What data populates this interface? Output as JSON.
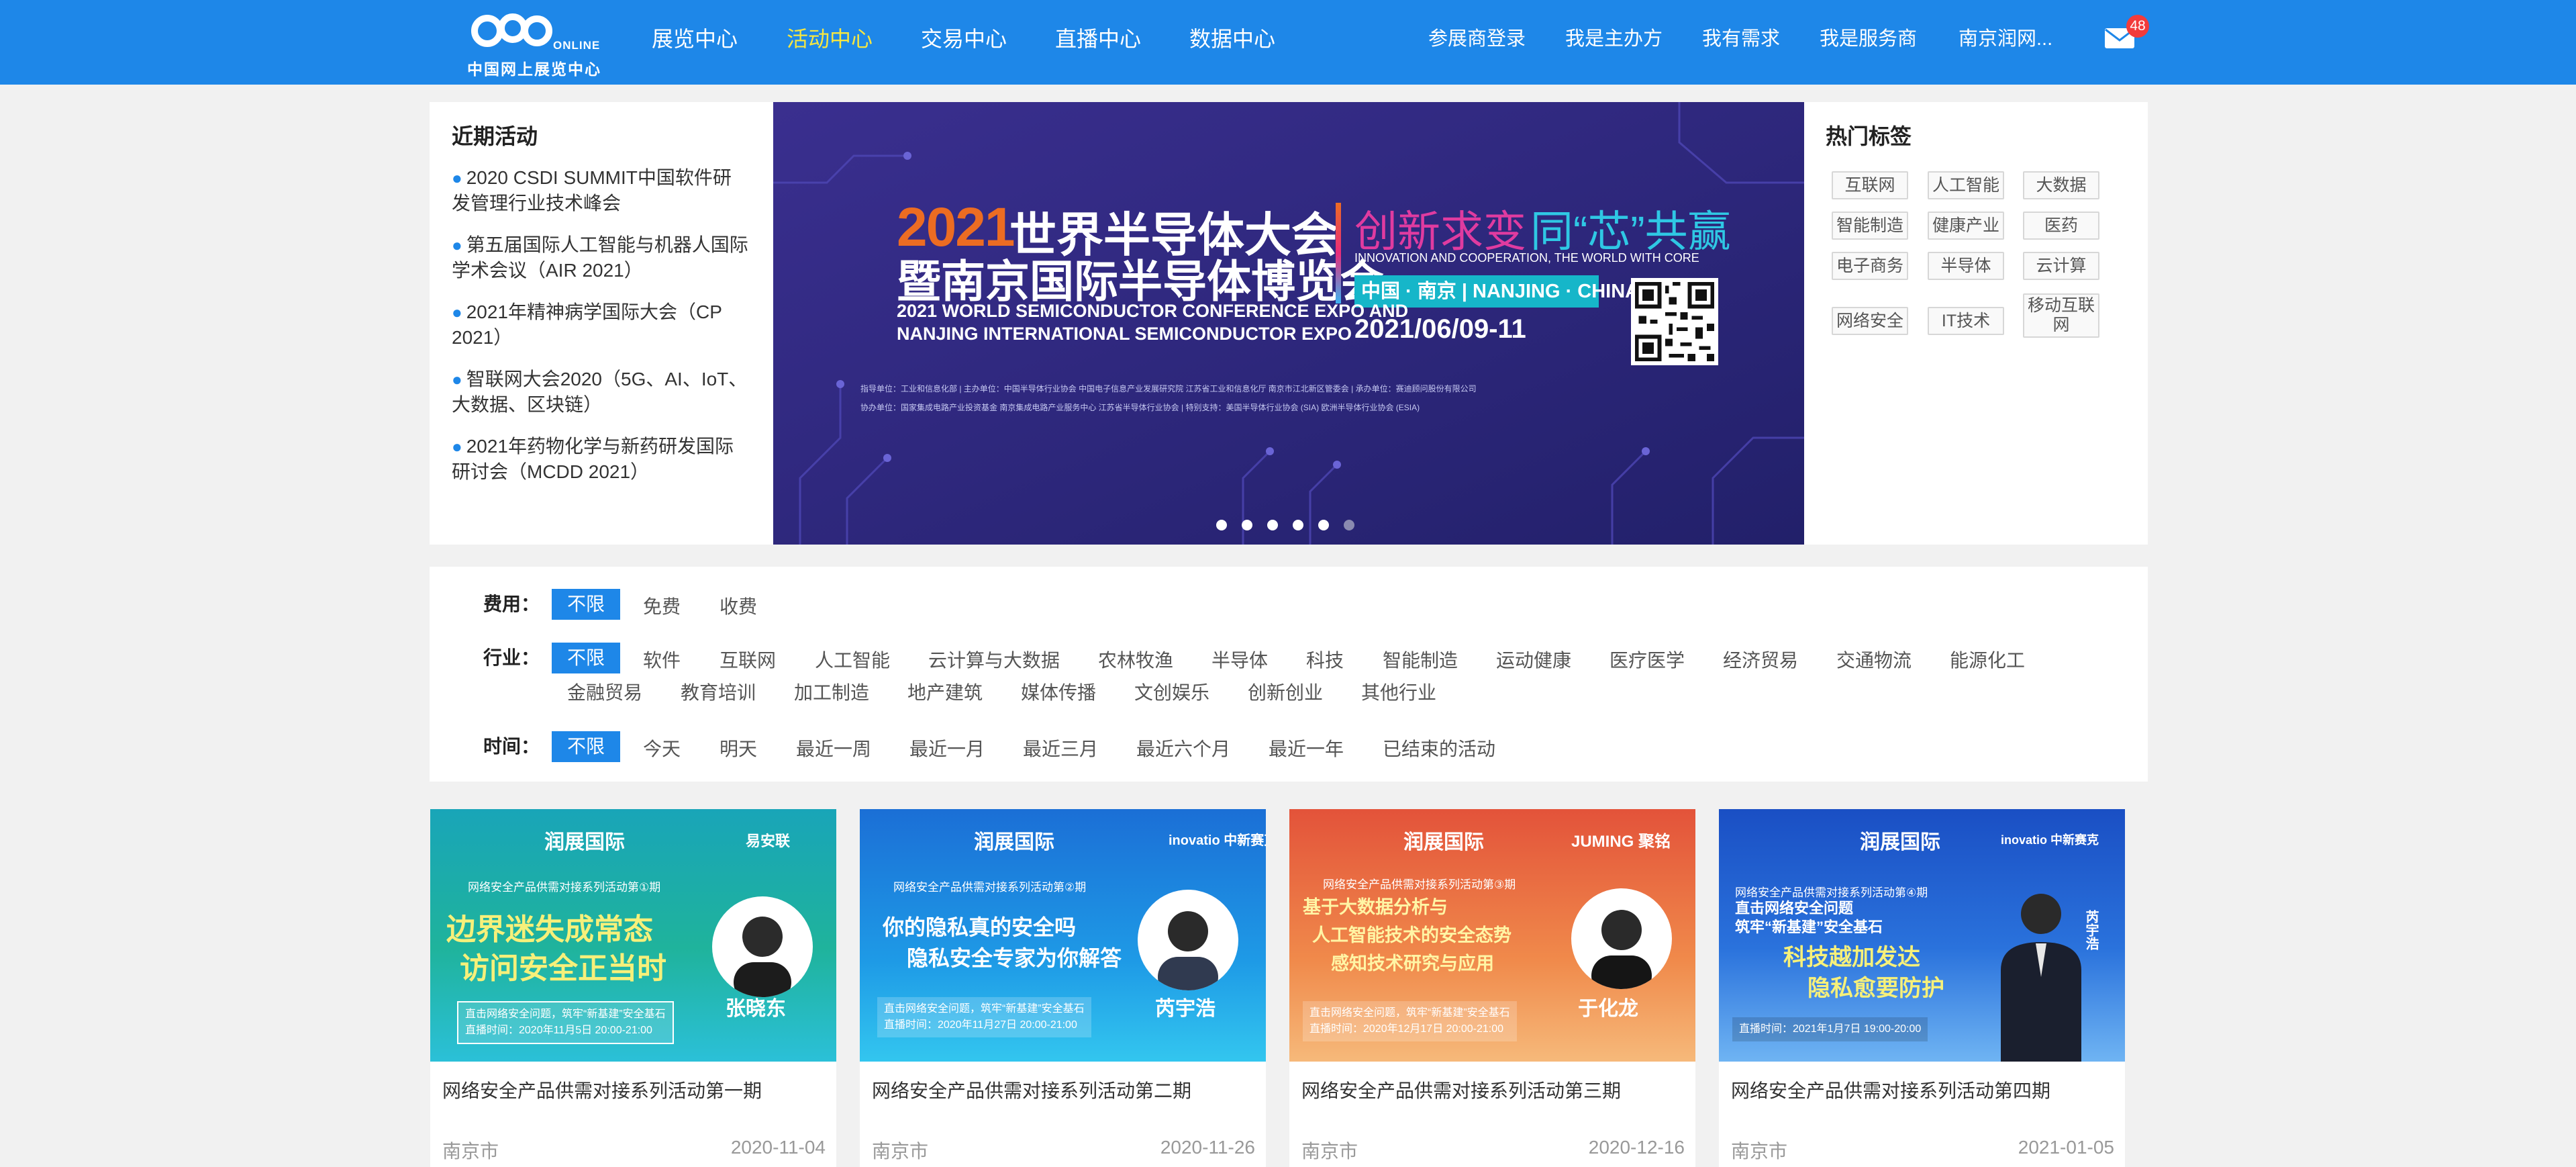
{
  "header": {
    "logo_text": "coo",
    "logo_online": "ONLINE",
    "logo_cn": "中国网上展览中心",
    "nav": [
      "展览中心",
      "活动中心",
      "交易中心",
      "直播中心",
      "数据中心"
    ],
    "active_nav": "活动中心",
    "right_links": [
      "参展商登录",
      "我是主办方",
      "我有需求",
      "我是服务商",
      "南京润网..."
    ],
    "mail_count": "48"
  },
  "recent": {
    "title": "近期活动",
    "items": [
      {
        "line1": "2020 CSDI SUMMIT中国软件研",
        "line2": "发管理行业技术峰会"
      },
      {
        "line1": "第五届国际人工智能与机器人国际",
        "line2": "学术会议（AIR 2021）"
      },
      {
        "line1": "2021年精神病学国际大会（CP",
        "line2": "2021）"
      },
      {
        "line1": "智联网大会2020（5G、AI、IoT、",
        "line2": "大数据、区块链）"
      },
      {
        "line1": "2021年药物化学与新药研发国际",
        "line2": "研讨会（MCDD 2021）"
      }
    ]
  },
  "banner": {
    "year": "2021",
    "title_line1": "世界半导体大会",
    "title_line2": "暨南京国际半导体博览会",
    "slogan_a": "创新求变",
    "slogan_b": "同“芯”共赢",
    "slogan_en": "INNOVATION AND COOPERATION, THE WORLD WITH CORE",
    "location": "中国 · 南京 | NANJING · CHINA",
    "en_line1": "2021 WORLD SEMICONDUCTOR CONFERENCE EXPO AND",
    "en_line2": "NANJING INTERNATIONAL SEMICONDUCTOR EXPO",
    "date": "2021/06/09-11",
    "small_1": "指导单位：工业和信息化部 | 主办单位：中国半导体行业协会 中国电子信息产业发展研究院 江苏省工业和信息化厅 南京市江北新区管委会 | 承办单位：赛迪顾问股份有限公司",
    "small_2": "协办单位：国家集成电路产业投资基金 南京集成电路产业服务中心 江苏省半导体行业协会 | 特别支持：美国半导体行业协会 (SIA) 欧洲半导体行业协会 (ESIA)",
    "slide_count": 6,
    "active_slide": 6
  },
  "hot_tags": {
    "title": "热门标签",
    "tags": [
      "互联网",
      "人工智能",
      "大数据",
      "智能制造",
      "健康产业",
      "医药",
      "电子商务",
      "半导体",
      "云计算",
      "网络安全",
      "IT技术",
      "移动互联网"
    ]
  },
  "filter": {
    "fee_label": "费用：",
    "fee_options": [
      "不限",
      "免费",
      "收费"
    ],
    "industry_label": "行业：",
    "industry_options": [
      "不限",
      "软件",
      "互联网",
      "人工智能",
      "云计算与大数据",
      "农林牧渔",
      "半导体",
      "科技",
      "智能制造",
      "运动健康",
      "医疗医学",
      "经济贸易",
      "交通物流",
      "能源化工",
      "金融贸易",
      "教育培训",
      "加工制造",
      "地产建筑",
      "媒体传播",
      "文创娱乐",
      "创新创业",
      "其他行业"
    ],
    "time_label": "时间：",
    "time_options": [
      "不限",
      "今天",
      "明天",
      "最近一周",
      "最近一月",
      "最近三月",
      "最近六个月",
      "最近一年",
      "已结束的活动"
    ]
  },
  "cards": [
    {
      "title": "网络安全产品供需对接系列活动第一期",
      "city": "南京市",
      "date": "2020-11-04",
      "brand": "润展国际",
      "partner": "易安联",
      "series": "网络安全产品供需对接系列活动第①期",
      "head1": "边界迷失成常态",
      "head2": "访问安全正当时",
      "speaker": "张晓东",
      "box1": "直击网络安全问题，筑牢“新基建”安全基石",
      "box2": "直播时间：2020年11月5日 20:00-21:00"
    },
    {
      "title": "网络安全产品供需对接系列活动第二期",
      "city": "南京市",
      "date": "2020-11-26",
      "brand": "润展国际",
      "partner": "inovatio 中新赛克",
      "series": "网络安全产品供需对接系列活动第②期",
      "head1": "你的隐私真的安全吗",
      "head2": "隐私安全专家为你解答",
      "speaker": "芮宇浩",
      "box1": "直击网络安全问题，筑牢“新基建”安全基石",
      "box2": "直播时间：2020年11月27日 20:00-21:00"
    },
    {
      "title": "网络安全产品供需对接系列活动第三期",
      "city": "南京市",
      "date": "2020-12-16",
      "brand": "润展国际",
      "partner": "JUMING 聚铭",
      "series": "网络安全产品供需对接系列活动第③期",
      "head1": "基于大数据分析与",
      "head2": "人工智能技术的安全态势",
      "head3": "感知技术研究与应用",
      "speaker": "于化龙",
      "box1": "直击网络安全问题，筑牢“新基建”安全基石",
      "box2": "直播时间：2020年12月17日 20:00-21:00"
    },
    {
      "title": "网络安全产品供需对接系列活动第四期",
      "city": "南京市",
      "date": "2021-01-05",
      "brand": "润展国际",
      "partner": "inovatio 中新赛克",
      "series": "网络安全产品供需对接系列活动第④期",
      "head1": "直击网络安全问题",
      "head2": "筑牢“新基建”安全基石",
      "head3": "科技越加发达",
      "head4": "隐私愈要防护",
      "speaker": "芮宇浩",
      "box2": "直播时间：2021年1月7日 19:00-20:00"
    }
  ]
}
